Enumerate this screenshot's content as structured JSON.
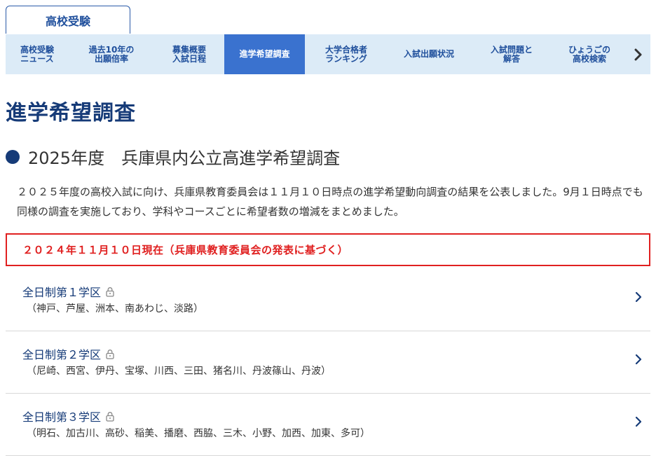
{
  "top_tab": {
    "label": "高校受験"
  },
  "nav": {
    "items": [
      {
        "line1": "高校受験",
        "line2": "ニュース",
        "active": false
      },
      {
        "line1": "過去10年の",
        "line2": "出願倍率",
        "active": false
      },
      {
        "line1": "募集概要",
        "line2": "入試日程",
        "active": false
      },
      {
        "line1": "進学希望調査",
        "line2": "",
        "active": true
      },
      {
        "line1": "大学合格者",
        "line2": "ランキング",
        "active": false
      },
      {
        "line1": "入試出願状況",
        "line2": "",
        "active": false
      },
      {
        "line1": "入試問題と",
        "line2": "解答",
        "active": false
      },
      {
        "line1": "ひょうごの",
        "line2": "高校検索",
        "active": false
      }
    ],
    "next_icon": "chevron-right-icon"
  },
  "page": {
    "title": "進学希望調査",
    "subheading": "2025年度　兵庫県内公立高進学希望調査",
    "intro": "２０２５年度の高校入試に向け、兵庫県教育委員会は１１月１０日時点の進学希望動向調査の結果を公表しました。9月１日時点でも同様の調査を実施しており、学科やコースごとに希望者数の増減をまとめました。",
    "notice": "２０２４年１１月１０日現在（兵庫県教育委員会の発表に基づく）"
  },
  "districts": [
    {
      "title": "全日制第１学区",
      "areas": "（神戸、芦屋、洲本、南あわじ、淡路）"
    },
    {
      "title": "全日制第２学区",
      "areas": "（尼崎、西宮、伊丹、宝塚、川西、三田、猪名川、丹波篠山、丹波）"
    },
    {
      "title": "全日制第３学区",
      "areas": "（明石、加古川、高砂、稲美、播磨、西脇、三木、小野、加西、加東、多可）"
    }
  ],
  "colors": {
    "accent": "#163b78",
    "nav_bg": "#dcebf7",
    "nav_active": "#3a72cf",
    "notice_red": "#e02020"
  }
}
